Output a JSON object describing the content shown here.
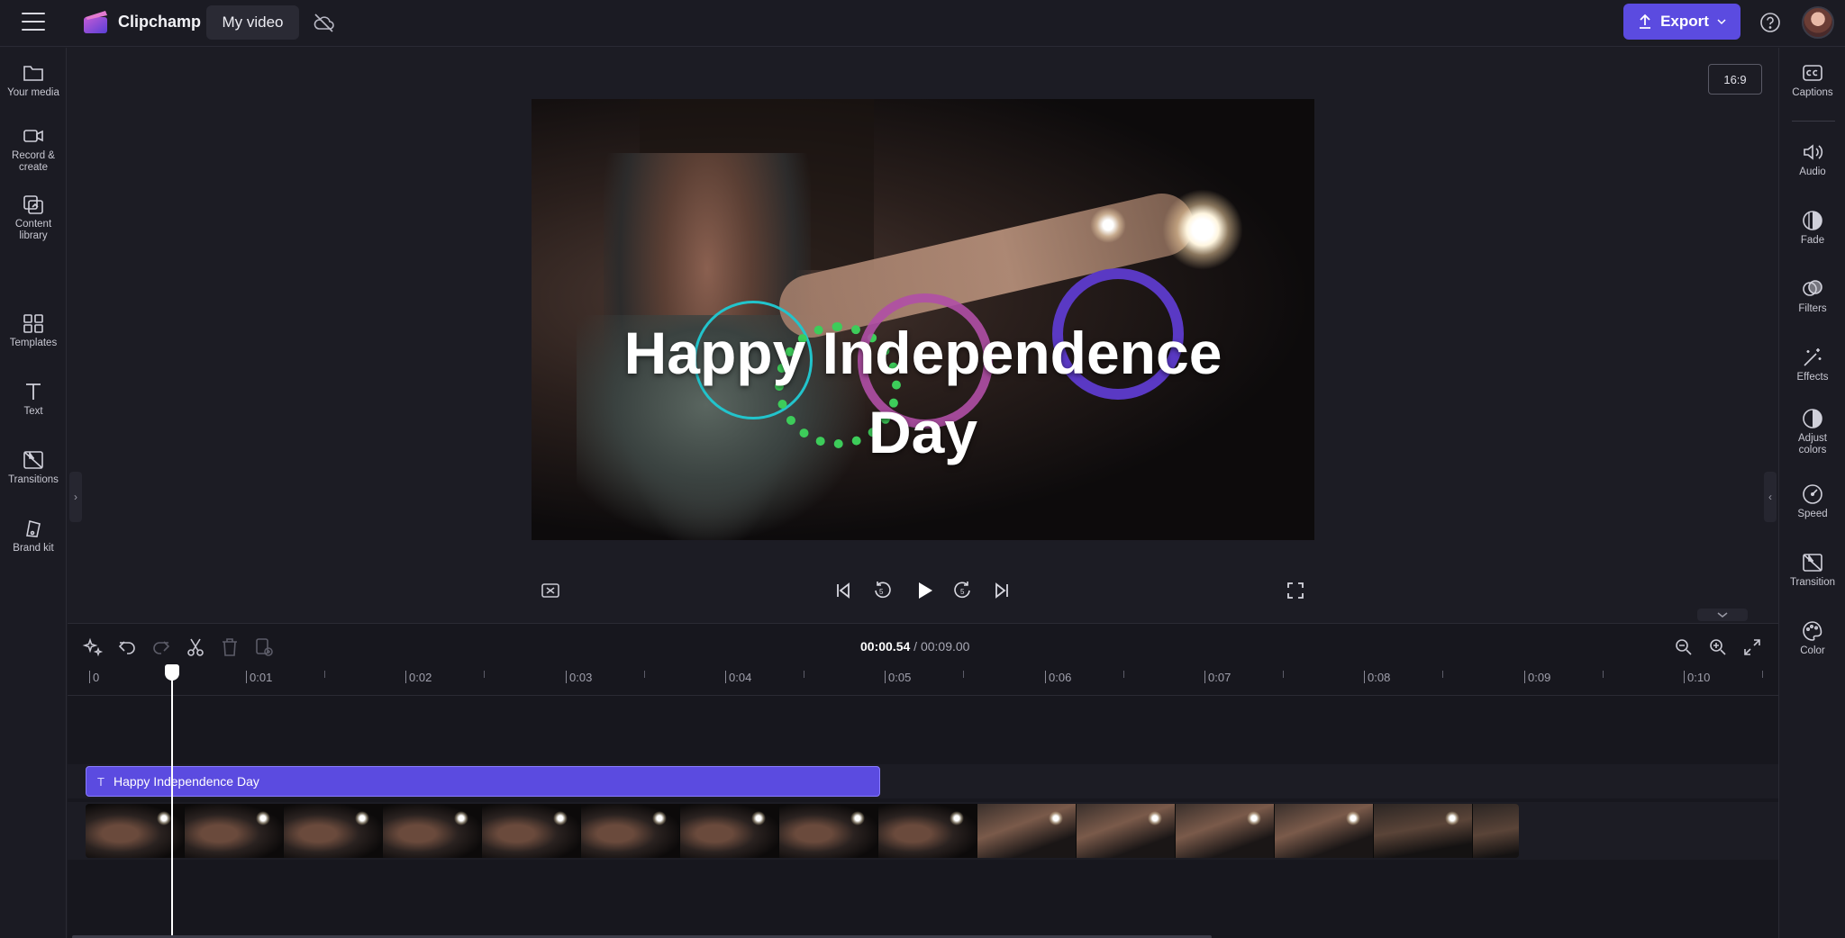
{
  "app": {
    "name": "Clipchamp",
    "project_title": "My video"
  },
  "header": {
    "export_label": "Export"
  },
  "left_rail": [
    {
      "label": "Your media"
    },
    {
      "label": "Record &\ncreate"
    },
    {
      "label": "Content\nlibrary"
    },
    {
      "label": "Templates"
    },
    {
      "label": "Text"
    },
    {
      "label": "Transitions"
    },
    {
      "label": "Brand kit"
    }
  ],
  "right_rail": [
    {
      "label": "Captions"
    },
    {
      "label": "Audio"
    },
    {
      "label": "Fade"
    },
    {
      "label": "Filters"
    },
    {
      "label": "Effects"
    },
    {
      "label": "Adjust\ncolors"
    },
    {
      "label": "Speed"
    },
    {
      "label": "Transition"
    },
    {
      "label": "Color"
    }
  ],
  "preview": {
    "aspect_ratio": "16:9",
    "title_line1": "Happy Independence",
    "title_line2": "Day",
    "ring_colors": [
      "#22c4cc",
      "#3dcc5a",
      "#b04fa6",
      "#5a39c4"
    ]
  },
  "timeline": {
    "current_time": "00:00.54",
    "total_time": "/ 00:09.00",
    "ruler": [
      "0",
      "0:01",
      "0:02",
      "0:03",
      "0:04",
      "0:05",
      "0:06",
      "0:07",
      "0:08",
      "0:09",
      "0:10"
    ],
    "text_clip_label": "Happy Independence Day"
  },
  "colors": {
    "accent": "#5b4be0",
    "background": "#1c1c24"
  }
}
